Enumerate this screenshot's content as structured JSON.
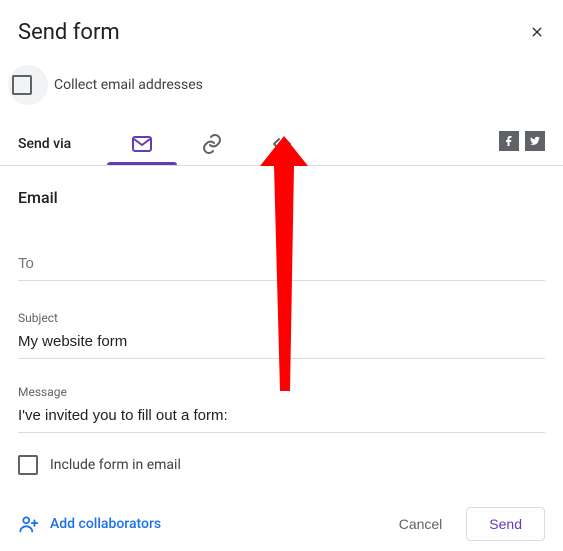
{
  "header": {
    "title": "Send form"
  },
  "collect": {
    "label": "Collect email addresses"
  },
  "send_via_label": "Send via",
  "section_heading": "Email",
  "fields": {
    "to": {
      "placeholder": "To"
    },
    "subject": {
      "label": "Subject",
      "value": "My website form"
    },
    "message": {
      "label": "Message",
      "value": "I've invited you to fill out a form:"
    }
  },
  "include": {
    "label": "Include form in email"
  },
  "footer": {
    "add_collab": "Add collaborators",
    "cancel": "Cancel",
    "send": "Send"
  }
}
